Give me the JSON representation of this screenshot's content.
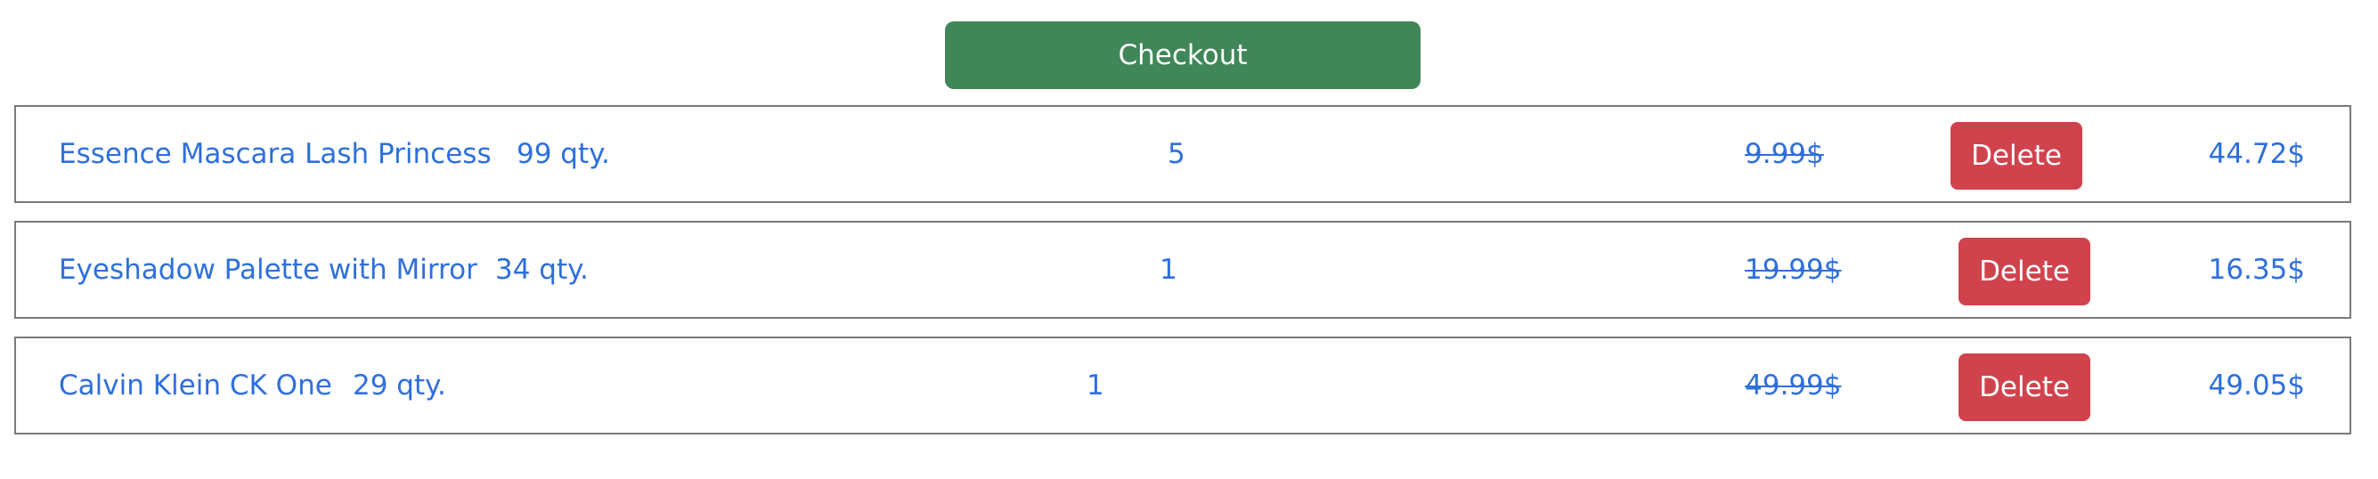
{
  "checkout": {
    "label": "Checkout"
  },
  "cart": {
    "items": [
      {
        "name": "Essence Mascara Lash Princess",
        "stock": "99 qty.",
        "quantity": "5",
        "old_price": "9.99$",
        "delete_label": "Delete",
        "price": "44.72$"
      },
      {
        "name": "Eyeshadow Palette with Mirror",
        "stock": "34 qty.",
        "quantity": "1",
        "old_price": "19.99$",
        "delete_label": "Delete",
        "price": "16.35$"
      },
      {
        "name": "Calvin Klein CK One",
        "stock": "29 qty.",
        "quantity": "1",
        "old_price": "49.99$",
        "delete_label": "Delete",
        "price": "49.05$"
      }
    ]
  },
  "colors": {
    "checkout_bg": "#3f8658",
    "delete_bg": "#d0434d",
    "text_link": "#2f6fdc",
    "row_border": "#7a7a7a"
  }
}
